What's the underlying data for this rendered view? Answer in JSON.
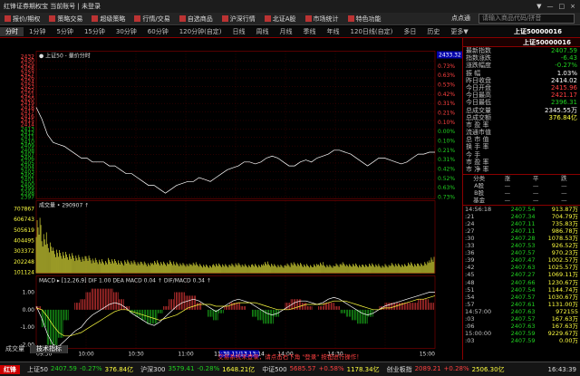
{
  "titlebar": {
    "title": "红锋证券期权宝   当前账号 | 未登录",
    "controls": [
      "▼",
      "—",
      "□",
      "×"
    ]
  },
  "menu": [
    {
      "label": "报价/期权",
      "icon": "quote-icon"
    },
    {
      "label": "策略交易",
      "icon": "strategy-icon"
    },
    {
      "label": "超级策略",
      "icon": "super-icon"
    },
    {
      "label": "行情/交易",
      "icon": "market-icon"
    },
    {
      "label": "自选商品",
      "icon": "favorite-icon"
    },
    {
      "label": "沪深行情",
      "icon": "hs-icon"
    },
    {
      "label": "北证A股",
      "icon": "bj-icon"
    },
    {
      "label": "市场统计",
      "icon": "stats-icon"
    },
    {
      "label": "特色功能",
      "icon": "feature-icon"
    }
  ],
  "search": {
    "button": "点点通",
    "placeholder": "请输入商品代码/拼音"
  },
  "periods": [
    "分时",
    "1分钟",
    "5分钟",
    "15分钟",
    "30分钟",
    "60分钟",
    "120分钟(自定)",
    "日线",
    "周线",
    "月线",
    "季线",
    "年线",
    "120日线(自定)",
    "多日",
    "历史",
    "更多▼"
  ],
  "symbol": "上证50000016",
  "chart": {
    "price_ticks": [
      "2432",
      "2430",
      "2429",
      "2428",
      "2427",
      "2426",
      "2424",
      "2423",
      "2422",
      "2421",
      "2420",
      "2419",
      "2418",
      "2417",
      "2416",
      "2415",
      "2414",
      "2413",
      "2412",
      "2411",
      "2410",
      "2409",
      "2408",
      "2407",
      "2406",
      "2405",
      "2404",
      "2403",
      "2402",
      "2401",
      "2400",
      "2399",
      "2398",
      "2397"
    ],
    "pct_ticks": [
      "0.83%",
      "0.73%",
      "0.63%",
      "0.53%",
      "0.42%",
      "0.31%",
      "0.21%",
      "0.10%",
      "0.00%",
      "0.10%",
      "0.21%",
      "0.31%",
      "0.42%",
      "0.52%",
      "0.63%",
      "0.73%"
    ],
    "legend": "● 上证50 - 量价分时",
    "current_price": "2433.32",
    "volume_label": "成交量 • 290907 ↑",
    "volume_ticks": [
      "707867",
      "606743",
      "505619",
      "404495",
      "303372",
      "202248",
      "101124"
    ],
    "macd_label": "MACD ▸ [12,26,9] DIF 1.00 DEA MACD 0.04 ↑ DIF/MACD 0.34 ↑",
    "macd_ticks": [
      "1.00",
      "0.00",
      "-1.00",
      "-2.00"
    ],
    "time_ticks": [
      "09:30",
      "10:00",
      "10:30",
      "11:00",
      "11:30/13:00",
      "13:14",
      "14:00",
      "14:30",
      "15:00"
    ],
    "time_marker": "11:30 11/13 13:14"
  },
  "tabs": [
    {
      "label": "成交量"
    },
    {
      "label": "技术指标"
    }
  ],
  "notice": "交易系统未登录，请点击右下角 \"登录\" 按钮进行操作！",
  "quote": [
    {
      "label": "最新指数",
      "value": "2407.59",
      "color": "green"
    },
    {
      "label": "指数涨跌",
      "value": "-6.43",
      "color": "green"
    },
    {
      "label": "涨跌幅度",
      "value": "-0.27%",
      "color": "green"
    },
    {
      "label": "振    幅",
      "value": "1.03%",
      "color": "white"
    },
    {
      "label": "昨日收盘",
      "value": "2414.02",
      "color": "white"
    },
    {
      "label": "今日开盘",
      "value": "2415.96",
      "color": "red"
    },
    {
      "label": "今日最高",
      "value": "2421.17",
      "color": "red"
    },
    {
      "label": "今日最低",
      "value": "2396.31",
      "color": "green"
    },
    {
      "label": "总成交量",
      "value": "2345.55万",
      "color": "white"
    },
    {
      "label": "总成交额",
      "value": "376.84亿",
      "color": "yellow"
    },
    {
      "label": "市 盈 率",
      "value": "",
      "color": "white"
    },
    {
      "label": "流通市值",
      "value": "",
      "color": "white"
    },
    {
      "label": "总 市 值",
      "value": "",
      "color": "white"
    },
    {
      "label": "换 手 率",
      "value": "",
      "color": "white"
    },
    {
      "label": "今    手",
      "value": "",
      "color": "white"
    },
    {
      "label": "市 盈 率",
      "value": "",
      "color": "white"
    },
    {
      "label": "市 净 率",
      "value": "",
      "color": "white"
    }
  ],
  "breadth": {
    "headers": [
      "分类",
      "涨",
      "平",
      "跌"
    ],
    "rows": [
      [
        "A股",
        "—",
        "—",
        "—"
      ],
      [
        "B股",
        "—",
        "—",
        "—"
      ],
      [
        "基金",
        "—",
        "—",
        "—"
      ]
    ]
  },
  "ticks": [
    {
      "time": "14:56:18",
      "price": "2407.54",
      "vol": "913.87万",
      "color": "green"
    },
    {
      "time": ":21",
      "price": "2407.34",
      "vol": "704.79万",
      "color": "green"
    },
    {
      "time": ":24",
      "price": "2407.11",
      "vol": "735.83万",
      "color": "green"
    },
    {
      "time": ":27",
      "price": "2407.11",
      "vol": "986.78万",
      "color": "green"
    },
    {
      "time": ":30",
      "price": "2407.28",
      "vol": "1078.53万",
      "color": "green"
    },
    {
      "time": ":33",
      "price": "2407.53",
      "vol": "926.52万",
      "color": "green"
    },
    {
      "time": ":36",
      "price": "2407.57",
      "vol": "970.23万",
      "color": "green"
    },
    {
      "time": ":39",
      "price": "2407.47",
      "vol": "1002.57万",
      "color": "green"
    },
    {
      "time": ":42",
      "price": "2407.63",
      "vol": "1025.57万",
      "color": "green"
    },
    {
      "time": ":45",
      "price": "2407.27",
      "vol": "1069.11万",
      "color": "green"
    },
    {
      "time": ":48",
      "price": "2407.66",
      "vol": "1230.67万",
      "color": "green"
    },
    {
      "time": ":51",
      "price": "2407.54",
      "vol": "1144.74万",
      "color": "green"
    },
    {
      "time": ":54",
      "price": "2407.57",
      "vol": "1030.67万",
      "color": "green"
    },
    {
      "time": ":57",
      "price": "2407.61",
      "vol": "1131.00万",
      "color": "green"
    },
    {
      "time": "14:57:00",
      "price": "2407.63",
      "vol": "972155",
      "color": "green"
    },
    {
      "time": ":03",
      "price": "2407.57",
      "vol": "167.63万",
      "color": "green"
    },
    {
      "time": ":06",
      "price": "2407.63",
      "vol": "167.63万",
      "color": "green"
    },
    {
      "time": "15:00:00",
      "price": "2407.59",
      "vol": "9229.67万",
      "color": "green"
    },
    {
      "time": ":03",
      "price": "2407.59",
      "vol": "0.00万",
      "color": "green"
    }
  ],
  "statusbar": {
    "logo": "红锋",
    "items": [
      {
        "name": "上证50",
        "value": "2407.59",
        "chg": "-0.27%",
        "amt": "376.84亿",
        "color": "green"
      },
      {
        "name": "沪深300",
        "value": "3579.41",
        "chg": "-0.28%",
        "amt": "1648.21亿",
        "color": "green"
      },
      {
        "name": "中证500",
        "value": "5685.57",
        "chg": "+0.58%",
        "amt": "1178.34亿",
        "color": "red"
      },
      {
        "name": "创业板指",
        "value": "2089.21",
        "chg": "+0.28%",
        "amt": "2506.30亿",
        "color": "red"
      }
    ],
    "clock": "16:43:39"
  },
  "colors": {
    "price_line": "#ffffff",
    "avg_line": "#ffff40",
    "up": "#ff4040",
    "down": "#20d020",
    "grid": "#8b0000",
    "volume_bar": "#ffff40"
  },
  "series": {
    "price": [
      2419,
      2416,
      2412,
      2410,
      2409.5,
      2409,
      2408,
      2407,
      2406,
      2406,
      2405,
      2405,
      2405,
      2404,
      2404,
      2403,
      2402,
      2402,
      2401,
      2400,
      2399,
      2399,
      2398,
      2397,
      2398,
      2399,
      2399.5,
      2400,
      2400,
      2401,
      2400.5,
      2400,
      2401,
      2402,
      2403,
      2403.5,
      2404,
      2405,
      2405,
      2404.5,
      2405,
      2406,
      2406.5,
      2406,
      2405,
      2404,
      2404,
      2405,
      2405.5,
      2405,
      2406,
      2406.5,
      2407,
      2408,
      2408,
      2407.5,
      2407,
      2406,
      2405,
      2404,
      2405,
      2406,
      2406,
      2405.5,
      2405,
      2404.5,
      2405,
      2406,
      2407,
      2407,
      2407.5,
      2407.5
    ],
    "volume": [
      0.95,
      0.7,
      0.55,
      0.42,
      0.38,
      0.35,
      0.33,
      0.3,
      0.28,
      0.3,
      0.26,
      0.24,
      0.22,
      0.25,
      0.23,
      0.2,
      0.22,
      0.21,
      0.19,
      0.2,
      0.18,
      0.22,
      0.2,
      0.19,
      0.21,
      0.18,
      0.17,
      0.16,
      0.18,
      0.16,
      0.15,
      0.14,
      0.17,
      0.16,
      0.15,
      0.16,
      0.17,
      0.15,
      0.14,
      0.16,
      0.15,
      0.2,
      0.17,
      0.15,
      0.14,
      0.16,
      0.18,
      0.17,
      0.15,
      0.14,
      0.16,
      0.19,
      0.15,
      0.14,
      0.16,
      0.18,
      0.15,
      0.16,
      0.14,
      0.15,
      0.17,
      0.16,
      0.14,
      0.15,
      0.17,
      0.16,
      0.15,
      0.18,
      0.16,
      0.17,
      0.2,
      0.28
    ],
    "macd_dif": [
      0.2,
      -0.5,
      -1.4,
      -2.0,
      -2.1,
      -1.8,
      -1.5,
      -1.2,
      -1.0,
      -0.6,
      -0.3,
      -0.1,
      0.1,
      0.3,
      0.4,
      0.3,
      0.1,
      -0.2,
      -0.4,
      -0.6,
      -0.8,
      -0.9,
      -0.7,
      -0.4,
      -0.1,
      0.2,
      0.4,
      0.5,
      0.6,
      0.5,
      0.3,
      0.1,
      -0.1,
      0.1,
      0.3,
      0.5,
      0.6,
      0.5,
      0.4,
      0.2,
      0.0,
      -0.2,
      -0.3,
      -0.2,
      0.0,
      0.2,
      0.4,
      0.5,
      0.5,
      0.4,
      0.3,
      0.4,
      0.6,
      0.7,
      0.6,
      0.4,
      0.2,
      0.0,
      -0.2,
      -0.3,
      -0.2,
      0.0,
      0.2,
      0.3,
      0.4,
      0.5,
      0.6,
      0.7,
      0.8,
      0.9,
      1.0,
      1.0
    ],
    "macd_dea": [
      0.1,
      0.0,
      -0.4,
      -0.9,
      -1.3,
      -1.5,
      -1.5,
      -1.4,
      -1.3,
      -1.1,
      -0.9,
      -0.7,
      -0.5,
      -0.3,
      -0.1,
      0.0,
      0.0,
      -0.1,
      -0.2,
      -0.3,
      -0.4,
      -0.5,
      -0.6,
      -0.5,
      -0.4,
      -0.3,
      -0.1,
      0.1,
      0.2,
      0.3,
      0.3,
      0.3,
      0.2,
      0.2,
      0.2,
      0.3,
      0.4,
      0.4,
      0.4,
      0.4,
      0.3,
      0.2,
      0.1,
      0.0,
      0.0,
      0.0,
      0.1,
      0.2,
      0.3,
      0.3,
      0.3,
      0.3,
      0.4,
      0.5,
      0.5,
      0.5,
      0.4,
      0.3,
      0.2,
      0.1,
      0.0,
      0.0,
      0.1,
      0.1,
      0.2,
      0.3,
      0.4,
      0.5,
      0.6,
      0.6,
      0.7,
      0.8
    ]
  }
}
